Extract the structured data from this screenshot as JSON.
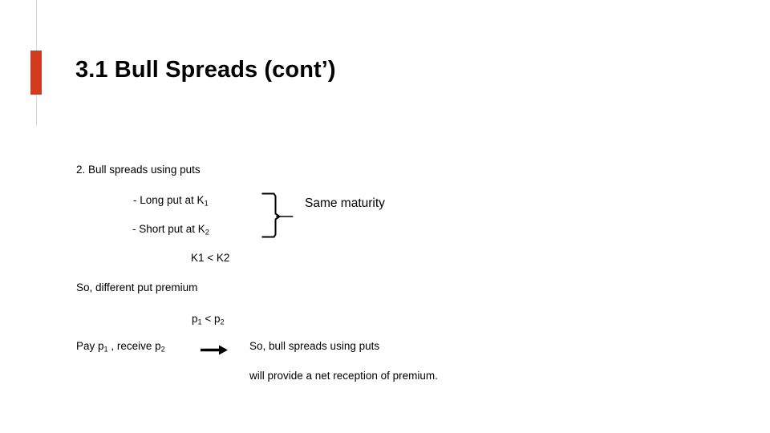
{
  "slide": {
    "title": "3.1 Bull Spreads (cont’)",
    "accent_color": "#d33a1e",
    "rule_color": "#d8d5d2",
    "background": "#ffffff",
    "ink_color": "#000000"
  },
  "body": {
    "bullet_heading": "2. Bull spreads using puts",
    "item_long": "- Long put at K",
    "item_long_sub": "1",
    "item_short": "- Short put at K",
    "item_short_sub": "2",
    "brace_note": "Same maturity",
    "strike_relation": "K1 < K2",
    "premium_note": "So, different put premium",
    "premium_relation_lhs": "p",
    "premium_relation_lhs_sub": "1",
    "premium_relation_op": " < ",
    "premium_relation_rhs": "p",
    "premium_relation_rhs_sub": "2",
    "pay_prefix": "Pay p",
    "pay_prefix_sub": "1",
    "pay_middle": " , receive p",
    "pay_middle_sub": "2",
    "conclusion_line1": "So, bull spreads using puts",
    "conclusion_line2": "will provide a net reception of premium."
  },
  "marks": {
    "brace_name": "curly-brace-mark",
    "arrow_name": "right-arrow-mark"
  }
}
